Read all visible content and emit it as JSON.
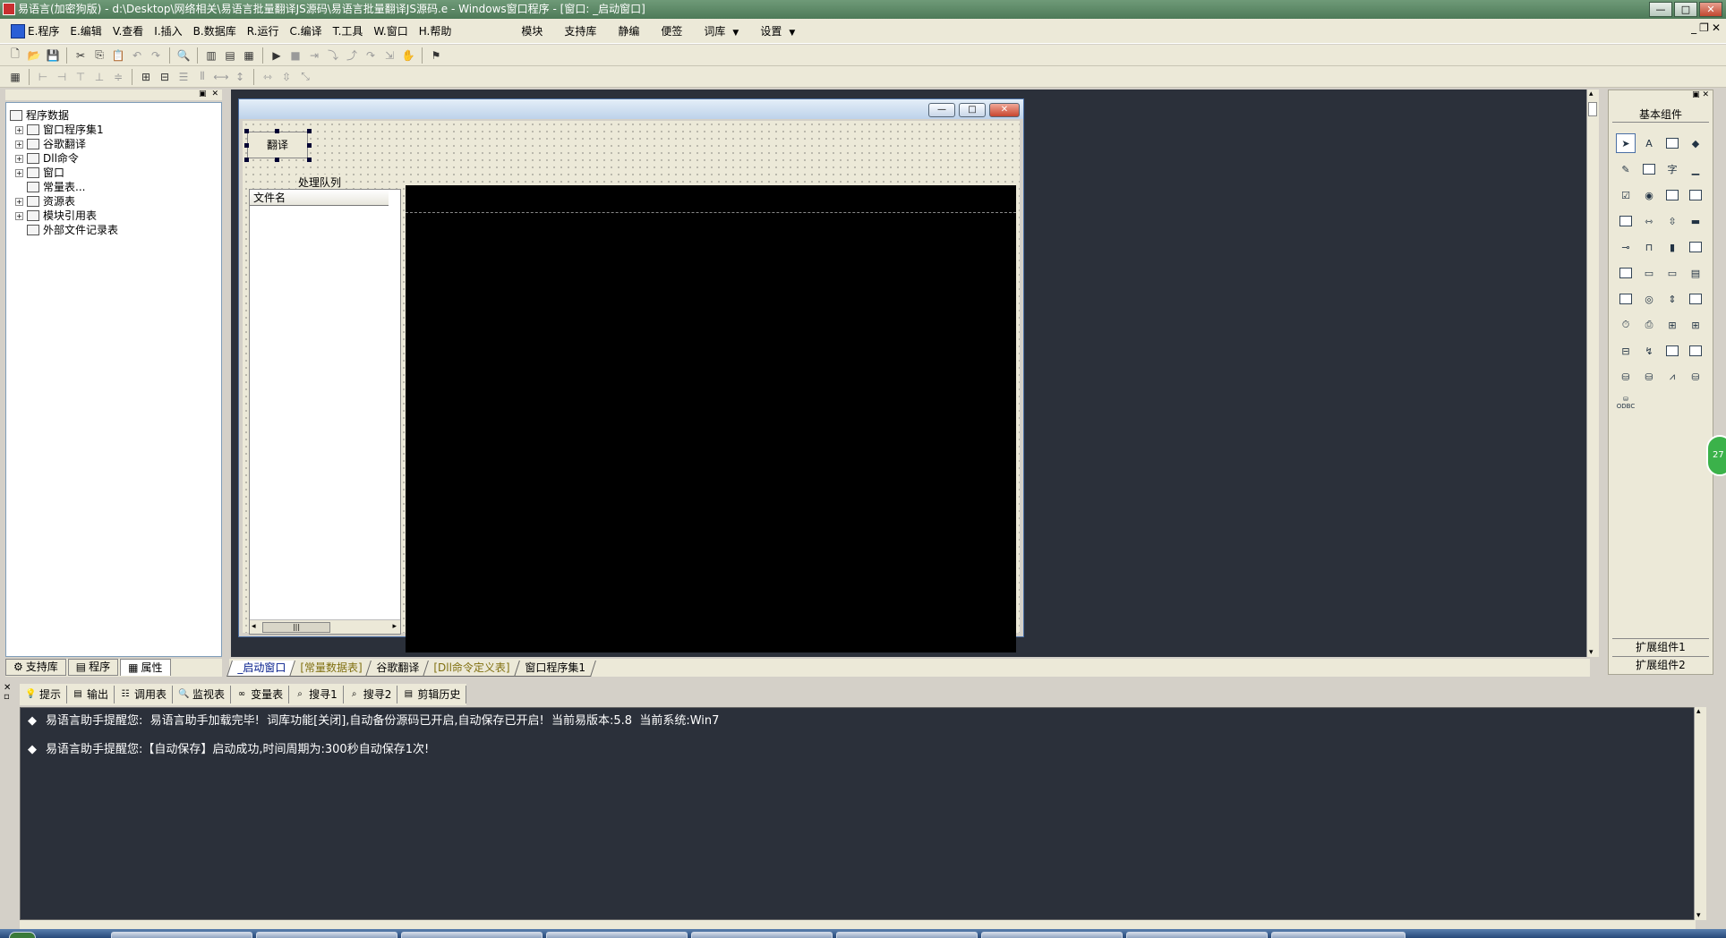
{
  "title": "易语言(加密狗版) - d:\\Desktop\\网络相关\\易语言批量翻译JS源码\\易语言批量翻译JS源码.e - Windows窗口程序 - [窗口: _启动窗口]",
  "window_buttons": {
    "minimize": "—",
    "maximize": "□",
    "close": "✕"
  },
  "menu": [
    "E.程序",
    "E.编辑",
    "V.查看",
    "I.插入",
    "B.数据库",
    "R.运行",
    "C.编译",
    "T.工具",
    "W.窗口",
    "H.帮助"
  ],
  "menu2": [
    "模块",
    "支持库",
    "静编",
    "便签",
    "词库",
    "设置"
  ],
  "mdi_controls": {
    "minimize": "_",
    "restore": "❐",
    "close": "✕"
  },
  "tree": {
    "root": "程序数据",
    "items": [
      "窗口程序集1",
      "谷歌翻译",
      "Dll命令",
      "窗口",
      "常量表...",
      "资源表",
      "模块引用表",
      "外部文件记录表"
    ]
  },
  "left_tabs": [
    "支持库",
    "程序",
    "属性"
  ],
  "form": {
    "button_label": "翻译",
    "queue_label": "处理队列",
    "list_header": "文件名",
    "scroll_thumb": "|||"
  },
  "palette": {
    "title": "基本组件",
    "ext1": "扩展组件1",
    "ext2": "扩展组件2",
    "odbc": "ODBC"
  },
  "badge": "27",
  "doc_tabs": [
    "_启动窗口",
    "[常量数据表]",
    "谷歌翻译",
    "[Dll命令定义表]",
    "窗口程序集1"
  ],
  "output_tabs": [
    "提示",
    "输出",
    "调用表",
    "监视表",
    "变量表",
    "搜寻1",
    "搜寻2",
    "剪辑历史"
  ],
  "output_lines": [
    "易语言助手提醒您:  易语言助手加载完毕!  词库功能[关闭],自动备份源码已开启,自动保存已开启!  当前易版本:5.8  当前系统:Win7",
    "易语言助手提醒您:【自动保存】启动成功,时间周期为:300秒自动保存1次!"
  ]
}
